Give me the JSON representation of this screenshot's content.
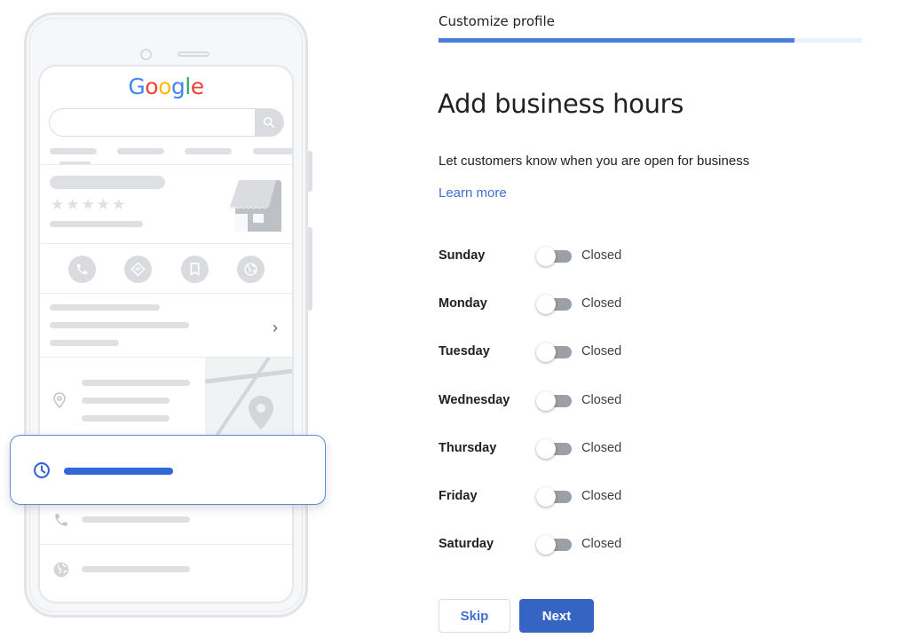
{
  "illustration": {
    "brand_letters": [
      {
        "char": "G",
        "color": "#4285f4"
      },
      {
        "char": "o",
        "color": "#ea4335"
      },
      {
        "char": "o",
        "color": "#fbbc05"
      },
      {
        "char": "g",
        "color": "#4285f4"
      },
      {
        "char": "l",
        "color": "#34a853"
      },
      {
        "char": "e",
        "color": "#ea4335"
      }
    ],
    "rating_stars": "★★★★★",
    "chevron": "›",
    "icons": [
      "search-icon",
      "phone-icon",
      "directions-icon",
      "bookmark-icon",
      "globe-icon",
      "location-pin-icon",
      "map-pin-icon",
      "clock-icon",
      "storefront-icon"
    ]
  },
  "header": {
    "step_title": "Customize profile",
    "progress": 0.84,
    "accent_color": "#4a7fd9"
  },
  "main": {
    "heading": "Add business hours",
    "description": "Let customers know when you are open for business",
    "learn_more": "Learn more",
    "days": [
      {
        "label": "Sunday",
        "open": false,
        "status": "Closed"
      },
      {
        "label": "Monday",
        "open": false,
        "status": "Closed"
      },
      {
        "label": "Tuesday",
        "open": false,
        "status": "Closed"
      },
      {
        "label": "Wednesday",
        "open": false,
        "status": "Closed"
      },
      {
        "label": "Thursday",
        "open": false,
        "status": "Closed"
      },
      {
        "label": "Friday",
        "open": false,
        "status": "Closed"
      },
      {
        "label": "Saturday",
        "open": false,
        "status": "Closed"
      }
    ]
  },
  "actions": {
    "skip_label": "Skip",
    "next_label": "Next"
  }
}
